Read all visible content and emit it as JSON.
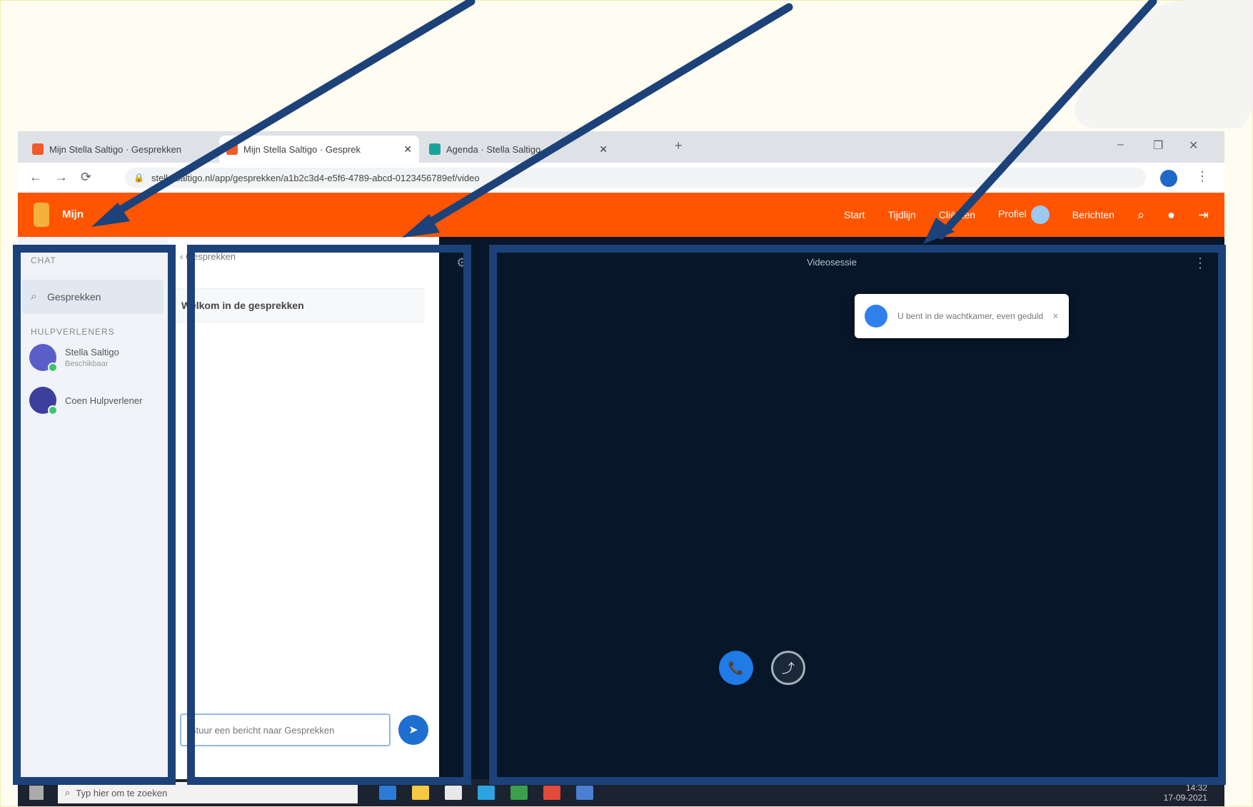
{
  "browser": {
    "tabs": [
      {
        "label": "Mijn Stella Saltigo · Gesprekken",
        "active": false,
        "color": "#f05a28"
      },
      {
        "label": "Mijn Stella Saltigo · Gesprek",
        "active": true,
        "color": "#f05a28"
      },
      {
        "label": "Agenda · Stella Saltigo",
        "active": false,
        "color": "#1aa39a"
      }
    ],
    "new_tab_icon": "+",
    "url": "stella.saltigo.nl/app/gesprekken/a1b2c3d4-e5f6-4789-abcd-0123456789ef/video",
    "win_controls": [
      "–",
      "❐",
      "✕"
    ]
  },
  "app": {
    "name": "Mijn",
    "nav": [
      "Start",
      "Tijdlijn",
      "Cliënten",
      "Profiel",
      "Berichten"
    ],
    "brand_color": "#ff5500"
  },
  "sidebar": {
    "section_chat": "CHAT",
    "active_item": {
      "icon": "search-icon",
      "label": "Gesprekken"
    },
    "section_contacts": "HULPVERLENERS",
    "contacts": [
      {
        "name": "Stella Saltigo",
        "subtitle": "Beschikbaar",
        "online": true
      },
      {
        "name": "Coen Hulpverlener",
        "subtitle": "",
        "online": true
      }
    ]
  },
  "conversation": {
    "back_label": "‹ Gesprekken",
    "title": "Welkom in de gesprekken",
    "input_placeholder": "Stuur een bericht naar Gesprekken",
    "send_icon": "➤"
  },
  "video": {
    "title": "Videosessie",
    "toast_text": "U bent in de wachtkamer, even geduld",
    "toast_close": "✕",
    "call_icon": "📞",
    "share_icon": "⤴"
  },
  "taskbar": {
    "search_placeholder": "Typ hier om te zoeken",
    "time": "14:32",
    "date": "17-09-2021",
    "app_colors": [
      "#2b7bd6",
      "#f4c842",
      "#e8e8e8",
      "#2fa3e0",
      "#3a9e4a",
      "#e24b3b",
      "#4a7fd1"
    ]
  },
  "annotation_color": "#1c4279"
}
